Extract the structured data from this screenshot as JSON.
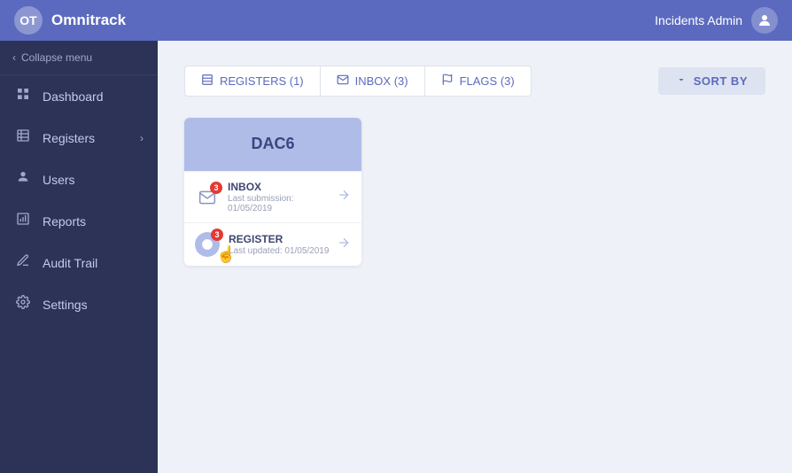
{
  "header": {
    "logo_text": "OT",
    "title": "Omnitrack",
    "user": "Incidents Admin",
    "avatar_icon": "👤"
  },
  "sidebar": {
    "collapse_label": "Collapse menu",
    "items": [
      {
        "id": "dashboard",
        "label": "Dashboard",
        "icon": "⊞",
        "has_chevron": false
      },
      {
        "id": "registers",
        "label": "Registers",
        "icon": "☰",
        "has_chevron": true
      },
      {
        "id": "users",
        "label": "Users",
        "icon": "👤",
        "has_chevron": false
      },
      {
        "id": "reports",
        "label": "Reports",
        "icon": "📊",
        "has_chevron": false
      },
      {
        "id": "audit-trail",
        "label": "Audit Trail",
        "icon": "✎",
        "has_chevron": false
      },
      {
        "id": "settings",
        "label": "Settings",
        "icon": "⚙",
        "has_chevron": false
      }
    ]
  },
  "filter_bar": {
    "tabs": [
      {
        "id": "registers",
        "label": "REGISTERS (1)",
        "icon": "▦"
      },
      {
        "id": "inbox",
        "label": "INBOX (3)",
        "icon": "✉"
      },
      {
        "id": "flags",
        "label": "FLAGS (3)",
        "icon": "⚑"
      }
    ],
    "sort_label": "SORT BY",
    "sort_icon": "▼"
  },
  "cards": [
    {
      "id": "dac6",
      "title": "DAC6",
      "items": [
        {
          "id": "inbox",
          "label": "INBOX",
          "sub": "Last submission: 01/05/2019",
          "badge": "3",
          "icon_type": "envelope"
        },
        {
          "id": "register",
          "label": "REGISTER",
          "sub": "Last updated: 01/05/2019",
          "badge": "3",
          "icon_type": "register"
        }
      ]
    }
  ],
  "colors": {
    "header_bg": "#5b6abf",
    "sidebar_bg": "#2c3357",
    "content_bg": "#eef1f7",
    "card_header_bg": "#b0bce8",
    "accent": "#5b6abf",
    "badge_red": "#e53935"
  }
}
